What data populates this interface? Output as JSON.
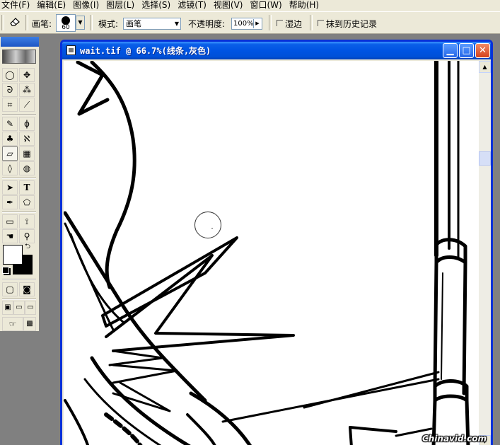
{
  "menu": [
    {
      "label": "文件(F)"
    },
    {
      "label": "编辑(E)"
    },
    {
      "label": "图像(I)"
    },
    {
      "label": "图层(L)"
    },
    {
      "label": "选择(S)"
    },
    {
      "label": "滤镜(T)"
    },
    {
      "label": "视图(V)"
    },
    {
      "label": "窗口(W)"
    },
    {
      "label": "帮助(H)"
    }
  ],
  "options": {
    "tool_icon": "eraser-icon",
    "brush_label": "画笔:",
    "brush_size": "60",
    "mode_label": "模式:",
    "mode_value": "画笔",
    "opacity_label": "不透明度:",
    "opacity_value": "100%",
    "wet_edges_label": "湿边",
    "erase_history_label": "抹到历史记录"
  },
  "toolbox": {
    "tools": [
      {
        "name": "marquee-tool",
        "glyph": "◯"
      },
      {
        "name": "move-tool",
        "glyph": "✥"
      },
      {
        "name": "lasso-tool",
        "glyph": "ᘐ"
      },
      {
        "name": "magic-wand-tool",
        "glyph": "⁂"
      },
      {
        "name": "crop-tool",
        "glyph": "⌗"
      },
      {
        "name": "slice-tool",
        "glyph": "⟋"
      },
      {
        "name": "healing-brush-tool",
        "glyph": "✎"
      },
      {
        "name": "brush-tool",
        "glyph": "ϕ"
      },
      {
        "name": "clone-stamp-tool",
        "glyph": "♣"
      },
      {
        "name": "history-brush-tool",
        "glyph": "ℵ"
      },
      {
        "name": "eraser-tool",
        "glyph": "▱"
      },
      {
        "name": "gradient-tool",
        "glyph": "▦"
      },
      {
        "name": "blur-tool",
        "glyph": "◊"
      },
      {
        "name": "dodge-tool",
        "glyph": "◍"
      },
      {
        "name": "path-select-tool",
        "glyph": "➤"
      },
      {
        "name": "type-tool",
        "glyph": "T"
      },
      {
        "name": "pen-tool",
        "glyph": "✒"
      },
      {
        "name": "shape-tool",
        "glyph": "⬠"
      },
      {
        "name": "notes-tool",
        "glyph": "▭"
      },
      {
        "name": "eyedropper-tool",
        "glyph": "⟟"
      },
      {
        "name": "hand-tool",
        "glyph": "☚"
      },
      {
        "name": "zoom-tool",
        "glyph": "⚲"
      }
    ],
    "active_tool": "eraser-tool",
    "foreground_color": "#ffffff",
    "background_color": "#000000"
  },
  "document": {
    "title": "wait.tif @ 66.7%(线条,灰色)",
    "minimize_icon": "minimize-icon",
    "maximize_icon": "maximize-icon",
    "close_icon": "close-icon"
  },
  "watermark": "Chinavid.com",
  "colors": {
    "xp_blue": "#0054e3",
    "xp_face": "#ece9d8",
    "workspace": "#808080"
  }
}
